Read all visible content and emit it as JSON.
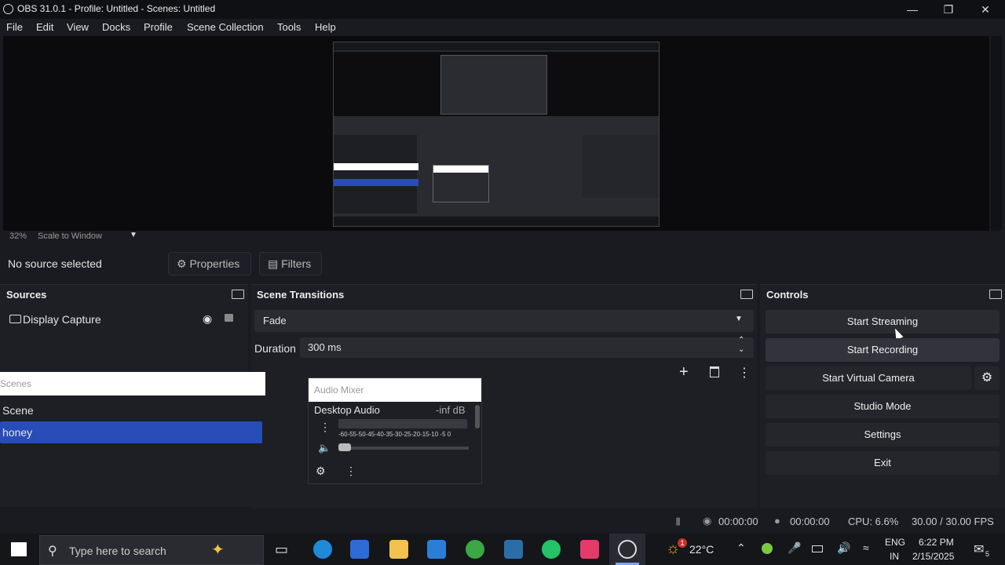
{
  "window": {
    "title": "OBS 31.0.1 - Profile: Untitled - Scenes: Untitled"
  },
  "menu": [
    "File",
    "Edit",
    "View",
    "Docks",
    "Profile",
    "Scene Collection",
    "Tools",
    "Help"
  ],
  "zoom": {
    "percent": "32%",
    "mode": "Scale to Window"
  },
  "source_toolbar": {
    "status": "No source selected",
    "properties": "Properties",
    "filters": "Filters"
  },
  "sources": {
    "title": "Sources",
    "items": [
      {
        "label": "Display Capture"
      }
    ]
  },
  "transitions": {
    "title": "Scene Transitions",
    "selected": "Fade",
    "duration_label": "Duration",
    "duration_value": "300 ms"
  },
  "scenes": {
    "title": "Scenes",
    "items": [
      {
        "label": "Scene"
      },
      {
        "label": "honey"
      }
    ]
  },
  "mixer": {
    "title": "Audio Mixer",
    "channel": "Desktop Audio",
    "level": "-inf dB",
    "scale": "-60-55-50-45-40-35-30-25-20-15-10 -5 0"
  },
  "controls": {
    "title": "Controls",
    "start_streaming": "Start Streaming",
    "start_recording": "Start Recording",
    "start_virtual_camera": "Start Virtual Camera",
    "studio_mode": "Studio Mode",
    "settings": "Settings",
    "exit": "Exit"
  },
  "status": {
    "stream_time": "00:00:00",
    "rec_time": "00:00:00",
    "cpu": "CPU: 6.6%",
    "fps": "30.00 / 30.00 FPS"
  },
  "taskbar": {
    "search_placeholder": "Type here to search",
    "weather": "22°C",
    "weather_badge": "1",
    "lang1": "ENG",
    "lang2": "IN",
    "time": "6:22 PM",
    "date": "2/15/2025",
    "notif_count": "5"
  },
  "colors": {
    "accent": "#284cb8",
    "bg": "#1e1f25"
  }
}
